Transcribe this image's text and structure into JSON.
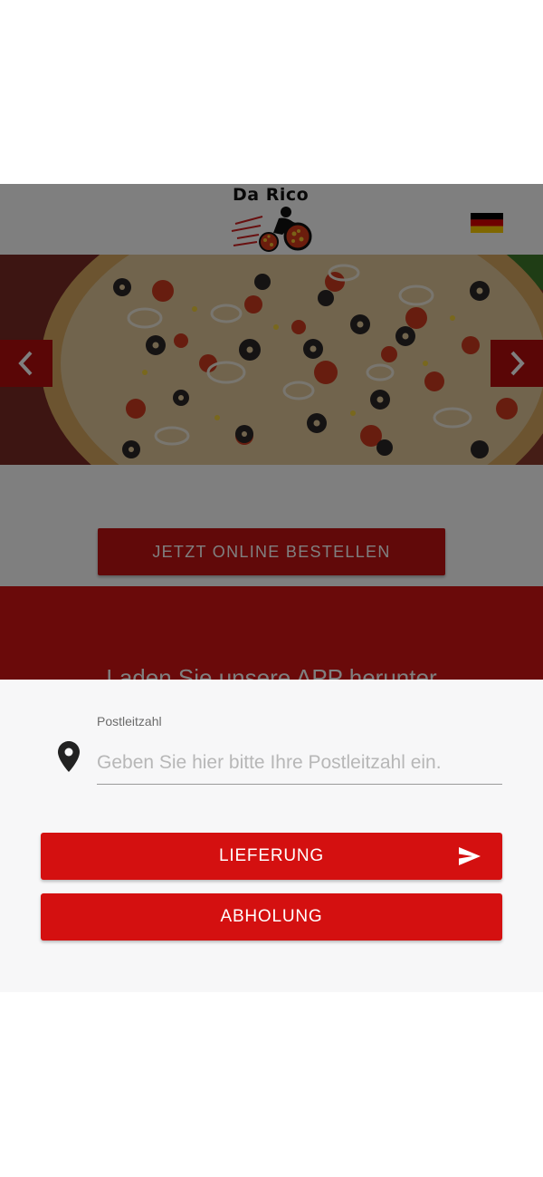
{
  "header": {
    "logo_text": "Da Rico",
    "language_flag": "german-flag-icon"
  },
  "slider": {
    "prev_icon": "chevron-left-icon",
    "next_icon": "chevron-right-icon",
    "image": "pizza-photo"
  },
  "cta": {
    "order_online_label": "JETZT ONLINE BESTELLEN"
  },
  "app_section": {
    "title": "Laden Sie unsere APP herunter"
  },
  "delivery_sheet": {
    "postcode_label": "Postleitzahl",
    "postcode_placeholder": "Geben Sie hier bitte Ihre Postleitzahl ein.",
    "postcode_value": "",
    "delivery_label": "LIEFERUNG",
    "pickup_label": "ABHOLUNG",
    "location_icon": "map-pin-icon",
    "send_icon": "send-icon"
  },
  "colors": {
    "brand_red": "#d41010",
    "sheet_bg": "#f7f7f8",
    "overlay": "rgba(0,0,0,0.5)"
  }
}
